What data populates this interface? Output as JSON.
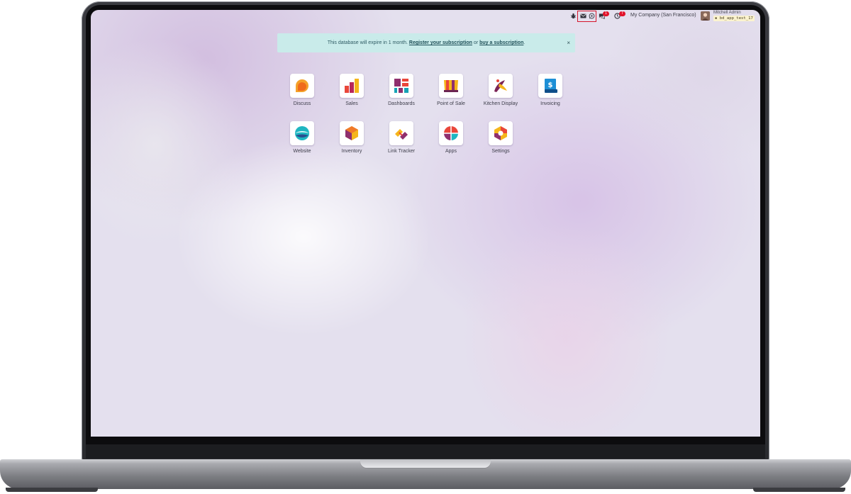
{
  "navbar": {
    "company": "My Company (San Francisco)",
    "user_name": "Mitchell Admin",
    "database": "bd_app_test_17",
    "chat_badge": "1",
    "activity_badge": "7"
  },
  "banner": {
    "text_before": "This database will expire in 1 month.",
    "link_register": "Register your subscription",
    "text_middle": "or",
    "link_buy": "buy a subscription",
    "text_after": ".",
    "close": "×"
  },
  "apps": [
    {
      "label": "Discuss",
      "icon": "discuss-icon"
    },
    {
      "label": "Sales",
      "icon": "sales-icon"
    },
    {
      "label": "Dashboards",
      "icon": "dashboards-icon"
    },
    {
      "label": "Point of Sale",
      "icon": "point-of-sale-icon"
    },
    {
      "label": "Kitchen Display",
      "icon": "kitchen-display-icon"
    },
    {
      "label": "Invoicing",
      "icon": "invoicing-icon"
    },
    {
      "label": "Website",
      "icon": "website-icon"
    },
    {
      "label": "Inventory",
      "icon": "inventory-icon"
    },
    {
      "label": "Link Tracker",
      "icon": "link-tracker-icon"
    },
    {
      "label": "Apps",
      "icon": "apps-icon"
    },
    {
      "label": "Settings",
      "icon": "settings-icon"
    }
  ],
  "colors": {
    "banner_bg": "#c9ebea",
    "badge": "#e1132b",
    "highlight": "#d6162b"
  }
}
